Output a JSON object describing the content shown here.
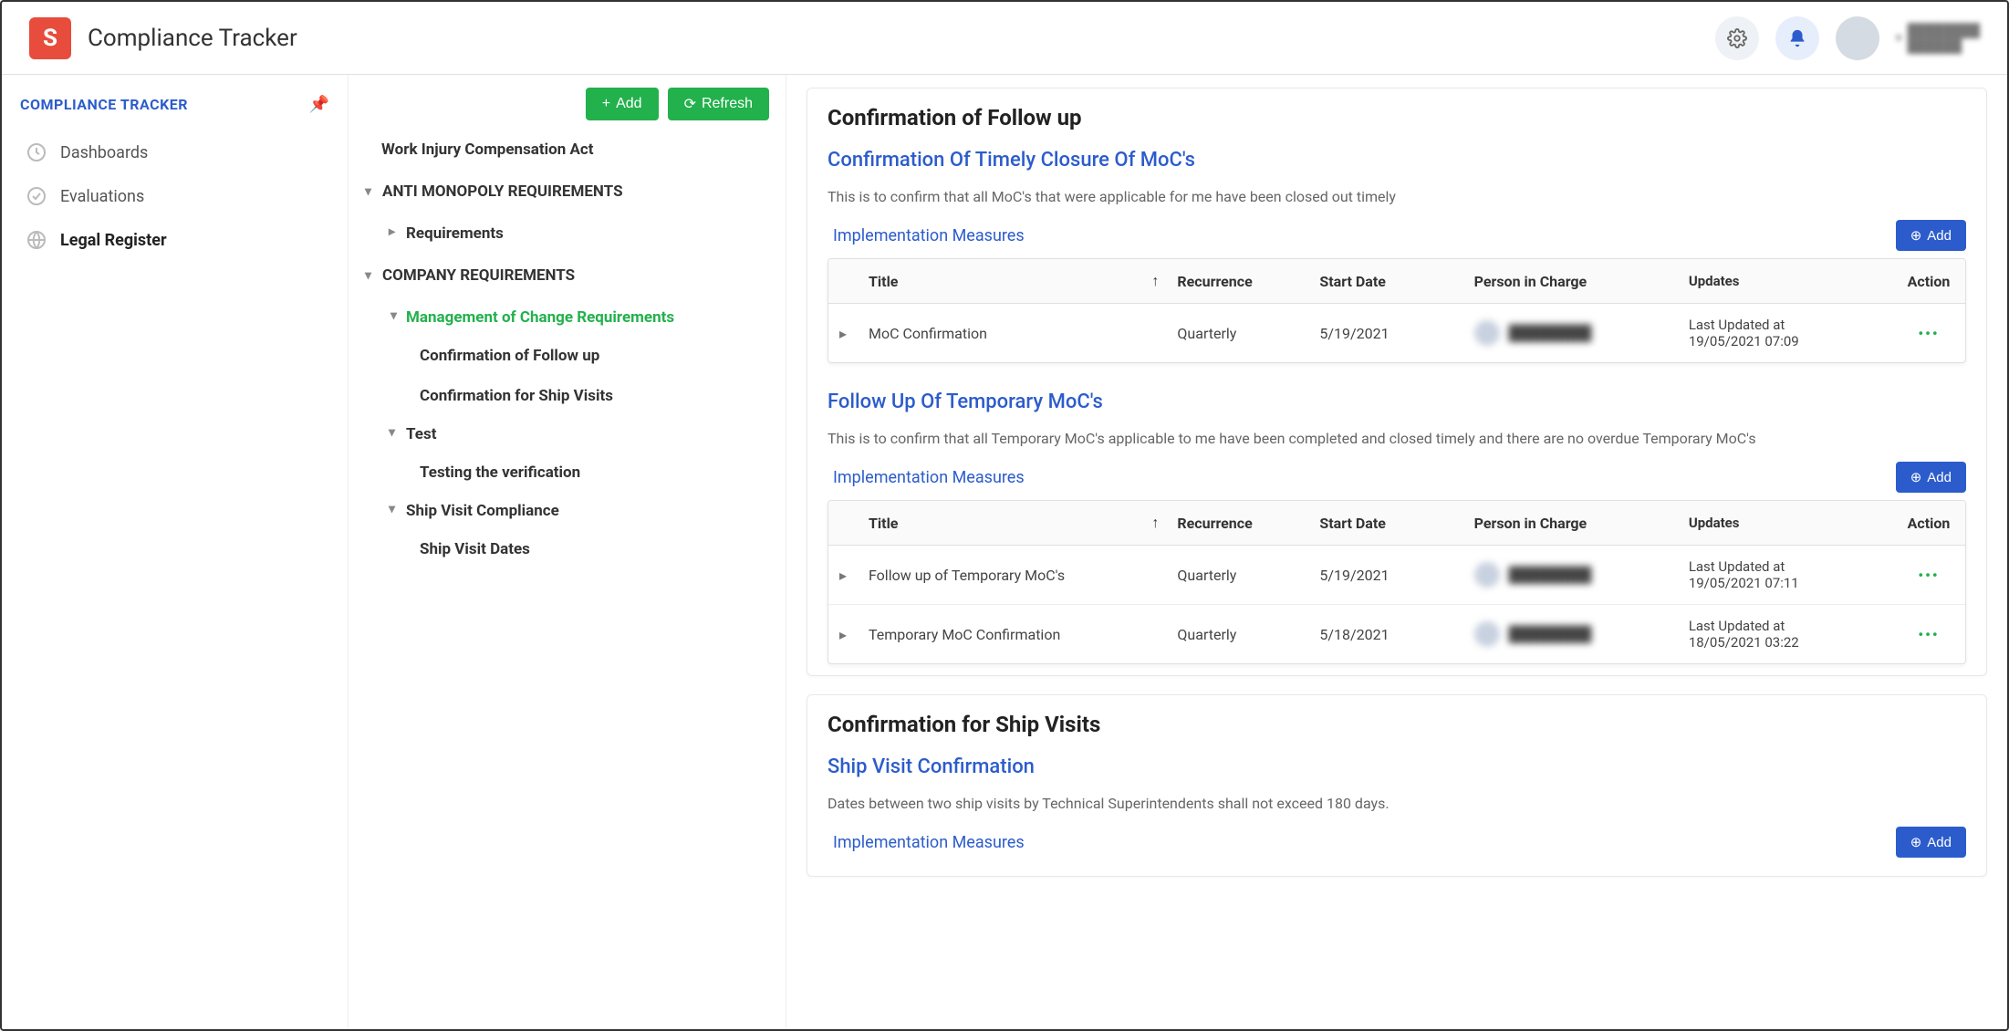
{
  "app": {
    "title": "Compliance Tracker",
    "logo_letter": "S"
  },
  "sidebar1": {
    "heading": "COMPLIANCE TRACKER",
    "items": [
      {
        "label": "Dashboards"
      },
      {
        "label": "Evaluations"
      },
      {
        "label": "Legal Register"
      }
    ]
  },
  "toolbar": {
    "add": "Add",
    "refresh": "Refresh"
  },
  "tree": {
    "item0": "Work Injury Compensation Act",
    "section1": "ANTI MONOPOLY REQUIREMENTS",
    "section1_child": "Requirements",
    "section2": "COMPANY REQUIREMENTS",
    "s2_c1": "Management of Change Requirements",
    "s2_c1_a": "Confirmation of Follow up",
    "s2_c1_b": "Confirmation for Ship Visits",
    "s2_c2": "Test",
    "s2_c2_a": "Testing the verification",
    "s2_c3": "Ship Visit Compliance",
    "s2_c3_a": "Ship Visit Dates"
  },
  "main": {
    "sec1": {
      "title": "Confirmation of Follow up",
      "link": "Confirmation Of Timely Closure Of MoC's",
      "desc": "This is to confirm that all MoC's that were applicable for me have been closed out timely",
      "impl": "Implementation Measures",
      "add": "Add",
      "cols": {
        "title": "Title",
        "rec": "Recurrence",
        "start": "Start Date",
        "person": "Person in Charge",
        "upd": "Updates",
        "act": "Action"
      },
      "rows": [
        {
          "title": "MoC Confirmation",
          "rec": "Quarterly",
          "start": "5/19/2021",
          "upd1": "Last Updated at",
          "upd2": "19/05/2021 07:09"
        }
      ]
    },
    "sec2": {
      "link": "Follow Up Of Temporary MoC's",
      "desc": "This is to confirm that all Temporary MoC's applicable to me have been completed and closed timely and there are no overdue Temporary MoC's",
      "impl": "Implementation Measures",
      "add": "Add",
      "cols": {
        "title": "Title",
        "rec": "Recurrence",
        "start": "Start Date",
        "person": "Person in Charge",
        "upd": "Updates",
        "act": "Action"
      },
      "rows": [
        {
          "title": "Follow up of Temporary MoC's",
          "rec": "Quarterly",
          "start": "5/19/2021",
          "upd1": "Last Updated at",
          "upd2": "19/05/2021 07:11"
        },
        {
          "title": "Temporary MoC Confirmation",
          "rec": "Quarterly",
          "start": "5/18/2021",
          "upd1": "Last Updated at",
          "upd2": "18/05/2021 03:22"
        }
      ]
    },
    "sec3": {
      "title": "Confirmation for Ship Visits",
      "link": "Ship Visit Confirmation",
      "desc": "Dates between two ship visits by Technical Superintendents shall not exceed 180 days.",
      "impl": "Implementation Measures",
      "add": "Add"
    }
  }
}
